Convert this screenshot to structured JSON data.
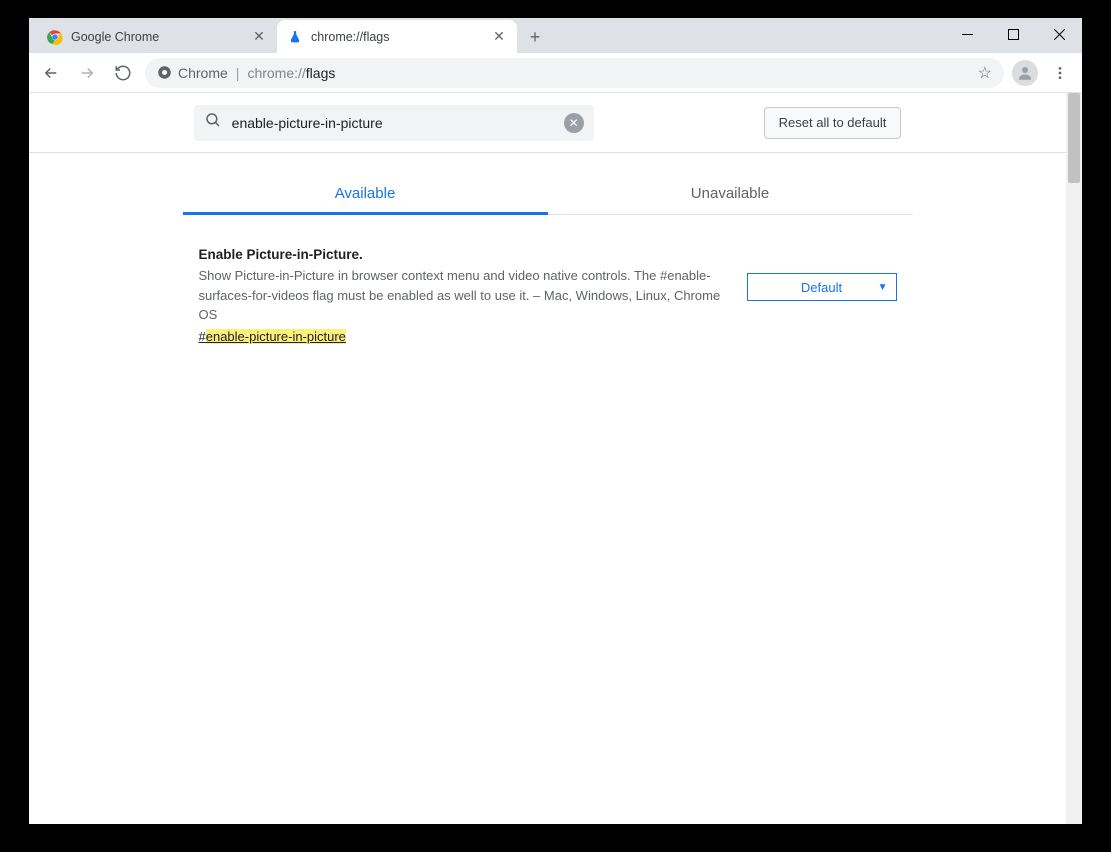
{
  "window": {
    "tabs": [
      {
        "title": "Google Chrome",
        "active": false
      },
      {
        "title": "chrome://flags",
        "active": true
      }
    ]
  },
  "omnibox": {
    "secure_label": "Chrome",
    "url_prefix": "chrome://",
    "url_bold": "flags"
  },
  "search": {
    "value": "enable-picture-in-picture"
  },
  "reset_button": "Reset all to default",
  "page_tabs": {
    "available": "Available",
    "unavailable": "Unavailable"
  },
  "flag": {
    "title": "Enable Picture-in-Picture.",
    "description": "Show Picture-in-Picture in browser context menu and video native controls. The #enable-surfaces-for-videos flag must be enabled as well to use it. – Mac, Windows, Linux, Chrome OS",
    "link_prefix": "#",
    "link_highlight": "enable-picture-in-picture",
    "select_value": "Default"
  }
}
